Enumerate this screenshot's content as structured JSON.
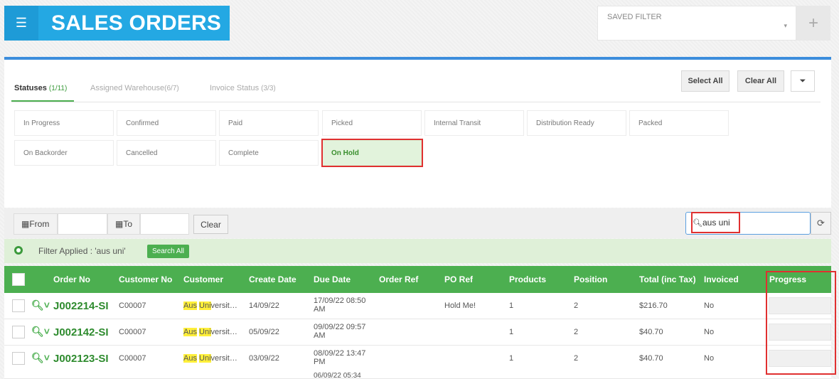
{
  "header": {
    "menu_icon": "hamburger-icon",
    "title": "SALES ORDERS"
  },
  "saved_filter": {
    "label": "SAVED FILTER",
    "arrow": "▾",
    "add_icon": "+"
  },
  "filter_tabs": [
    {
      "label": "Statuses",
      "count": "(1/11)"
    },
    {
      "label": "Assigned Warehouse",
      "count": "(6/7)"
    },
    {
      "label": "Invoice Status",
      "count": "(3/3)"
    }
  ],
  "actions": {
    "select_all": "Select All",
    "clear_all": "Clear All",
    "funnel": "⏷"
  },
  "statuses": [
    {
      "label": "In Progress"
    },
    {
      "label": "Confirmed"
    },
    {
      "label": "Paid"
    },
    {
      "label": "Picked"
    },
    {
      "label": "Internal Transit"
    },
    {
      "label": "Distribution Ready"
    },
    {
      "label": "Packed"
    },
    {
      "label": "On Backorder"
    },
    {
      "label": "Cancelled"
    },
    {
      "label": "Complete"
    },
    {
      "label": "On Hold",
      "selected": true
    }
  ],
  "date_filter": {
    "from": "From",
    "to": "To",
    "clear": "Clear"
  },
  "search": {
    "value": "aus uni",
    "refresh": "⟳"
  },
  "applied": {
    "text": "Filter Applied : 'aus uni'",
    "search_all": "Search All"
  },
  "table": {
    "headers": [
      "Order No",
      "Customer No",
      "Customer",
      "Create Date",
      "Due Date",
      "Order Ref",
      "PO Ref",
      "Products",
      "Position",
      "Total (inc Tax)",
      "Invoiced",
      "Progress"
    ],
    "rows": [
      {
        "order": "J002214-SI",
        "customer_no": "C00007",
        "cust_hl1": "Aus",
        "cust_hl2": "Uni",
        "cust_rest": "versit…",
        "create": "14/09/22",
        "due1": "17/09/22 08:50",
        "due2": "AM",
        "order_ref": "",
        "po_ref": "Hold Me!",
        "products": "1",
        "position": "2",
        "total": "$216.70",
        "invoiced": "No"
      },
      {
        "order": "J002142-SI",
        "customer_no": "C00007",
        "cust_hl1": "Aus",
        "cust_hl2": "Uni",
        "cust_rest": "versit…",
        "create": "05/09/22",
        "due1": "09/09/22 09:57",
        "due2": "AM",
        "order_ref": "",
        "po_ref": "",
        "products": "1",
        "position": "2",
        "total": "$40.70",
        "invoiced": "No"
      },
      {
        "order": "J002123-SI",
        "customer_no": "C00007",
        "cust_hl1": "Aus",
        "cust_hl2": "Uni",
        "cust_rest": "versit…",
        "create": "03/09/22",
        "due1": "08/09/22 13:47",
        "due2": "PM",
        "order_ref": "",
        "po_ref": "",
        "products": "1",
        "position": "2",
        "total": "$40.70",
        "invoiced": "No"
      }
    ],
    "partial_row_due": "06/09/22 05:34"
  },
  "colors": {
    "accent": "#4caf50",
    "header_blue": "#24a8e3",
    "highlight": "#ffef3a",
    "annotation": "#e03030"
  }
}
